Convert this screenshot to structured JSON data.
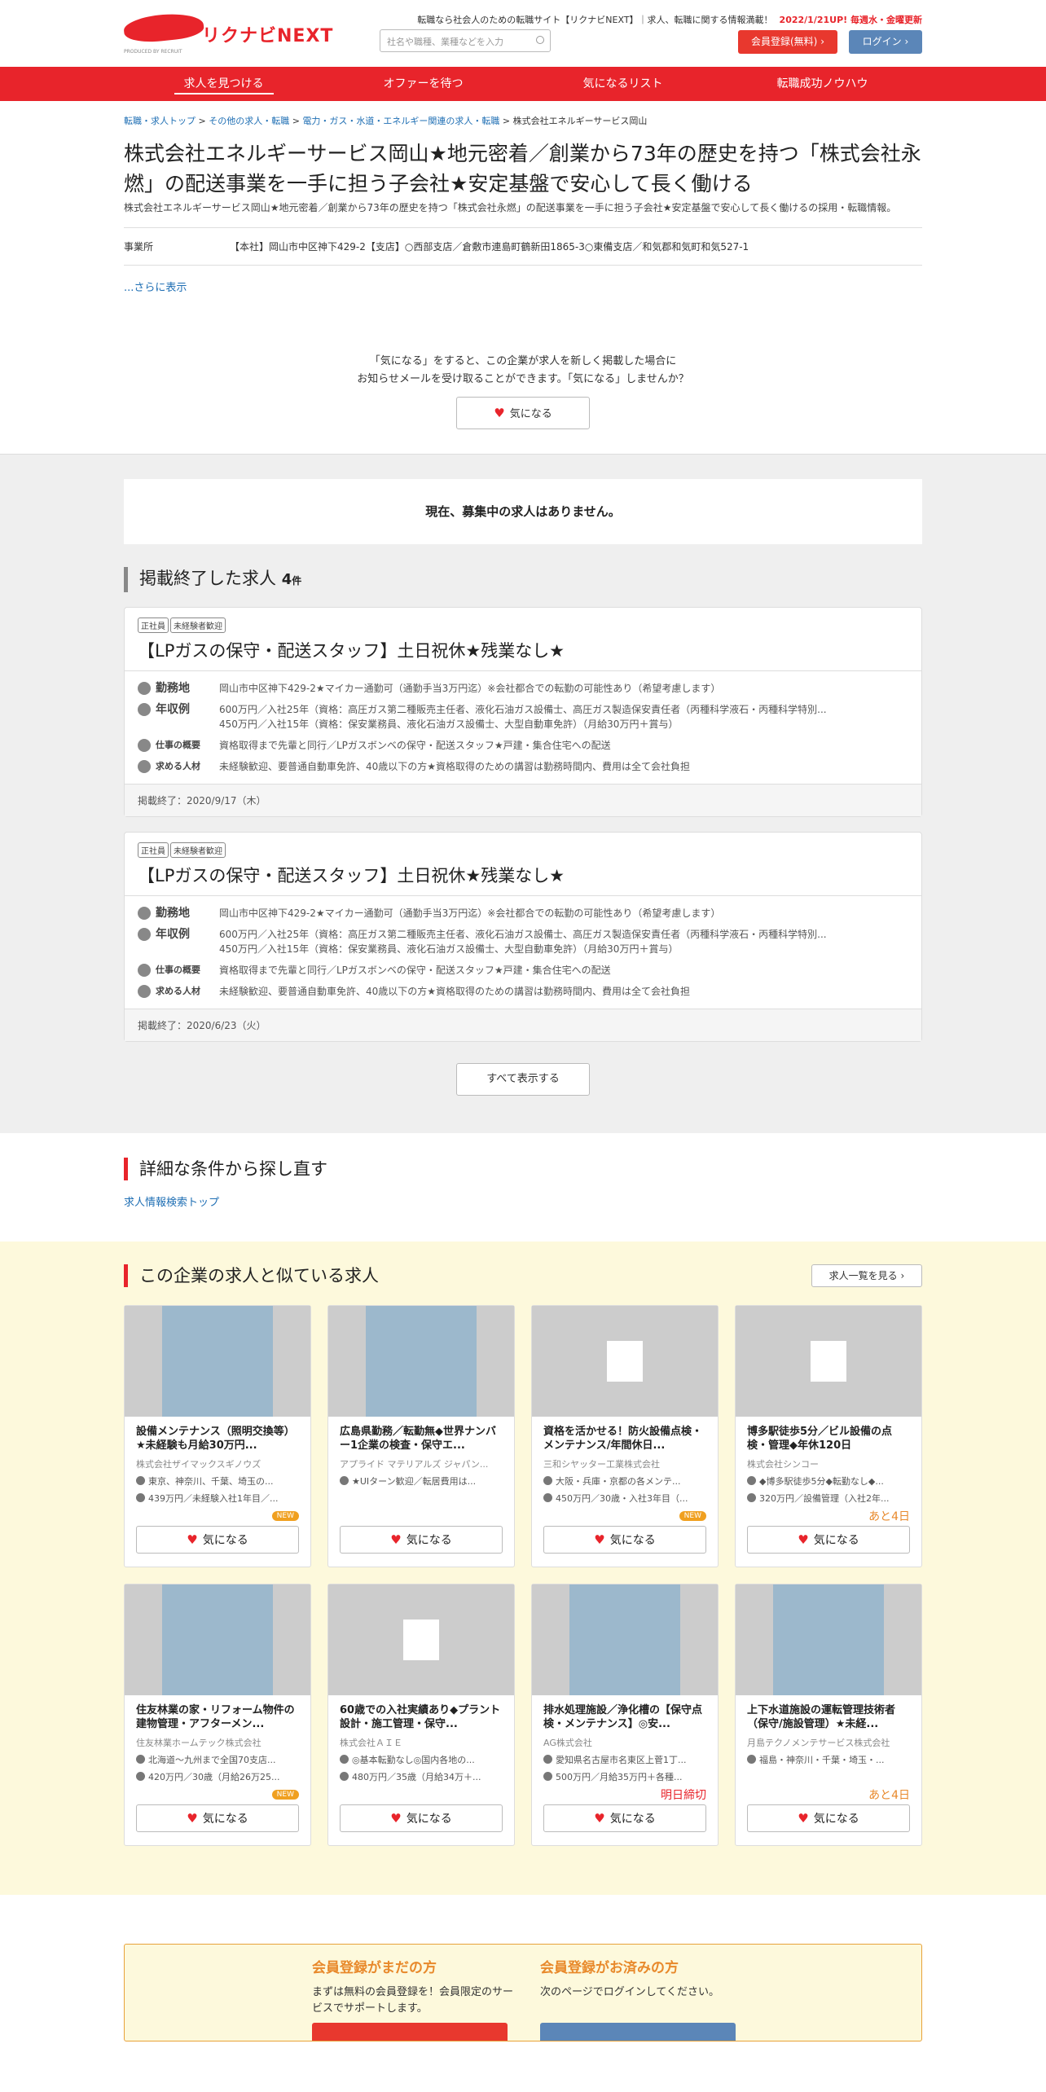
{
  "header": {
    "logo_text": "リクナビNEXT",
    "logo_sub": "PRODUCED BY RECRUIT",
    "tagline": "転職なら社会人のための転職サイト【リクナビNEXT】｜求人、転職に関する情報満載！",
    "update": "2022/1/21UP! 毎週水・金曜更新",
    "search_placeholder": "社名や職種、業種などを入力",
    "register_label": "会員登録(無料)",
    "login_label": "ログイン"
  },
  "nav": [
    "求人を見つける",
    "オファーを待つ",
    "気になるリスト",
    "転職成功ノウハウ"
  ],
  "breadcrumb": [
    "転職・求人トップ",
    "その他の求人・転職",
    "電力・ガス・水道・エネルギー関連の求人・転職",
    "株式会社エネルギーサービス岡山"
  ],
  "company": {
    "title": "株式会社エネルギーサービス岡山★地元密着／創業から73年の歴史を持つ「株式会社永燃」の配送事業を一手に担う子会社★安定基盤で安心して長く働ける",
    "subtitle": "株式会社エネルギーサービス岡山★地元密着／創業から73年の歴史を持つ「株式会社永燃」の配送事業を一手に担う子会社★安定基盤で安心して長く働けるの採用・転職情報。",
    "office_label": "事業所",
    "office_value": "【本社】岡山市中区神下429-2【支店】○西部支店／倉敷市連島町鶴新田1865-3○東備支店／和気郡和気町和気527-1",
    "more": "...さらに表示"
  },
  "favorite": {
    "line1": "「気になる」をすると、この企業が求人を新しく掲載した場合に",
    "line2": "お知らせメールを受け取ることができます。「気になる」しませんか？",
    "button": "気になる"
  },
  "no_jobs": "現在、募集中の求人はありません。",
  "ended": {
    "heading": "掲載終了した求人",
    "count": "4",
    "unit": "件",
    "jobs": [
      {
        "tags": [
          "正社員",
          "未経験者歓迎"
        ],
        "title": "【LPガスの保守・配送スタッフ】土日祝休★残業なし★",
        "loc_label": "勤務地",
        "loc": "岡山市中区神下429-2★マイカー通勤可（通勤手当3万円迄）※会社都合での転勤の可能性あり（希望考慮します）",
        "salary_label": "年収例",
        "salary1": "600万円／入社25年（資格：高圧ガス第二種販売主任者、液化石油ガス設備士、高圧ガス製造保安責任者（丙種科学液石・丙種科学特別...",
        "salary2": "450万円／入社15年（資格：保安業務員、液化石油ガス設備士、大型自動車免許）（月給30万円＋賞与）",
        "work_label": "仕事の概要",
        "work": "資格取得まで先輩と同行／LPガスボンベの保守・配送スタッフ★戸建・集合住宅への配送",
        "req_label": "求める人材",
        "req": "未経験歓迎、要普通自動車免許、40歳以下の方★資格取得のための講習は勤務時間内、費用は全て会社負担",
        "ended": "掲載終了：2020/9/17（木）"
      },
      {
        "tags": [
          "正社員",
          "未経験者歓迎"
        ],
        "title": "【LPガスの保守・配送スタッフ】土日祝休★残業なし★",
        "loc_label": "勤務地",
        "loc": "岡山市中区神下429-2★マイカー通勤可（通勤手当3万円迄）※会社都合での転勤の可能性あり（希望考慮します）",
        "salary_label": "年収例",
        "salary1": "600万円／入社25年（資格：高圧ガス第二種販売主任者、液化石油ガス設備士、高圧ガス製造保安責任者（丙種科学液石・丙種科学特別...",
        "salary2": "450万円／入社15年（資格：保安業務員、液化石油ガス設備士、大型自動車免許）（月給30万円＋賞与）",
        "work_label": "仕事の概要",
        "work": "資格取得まで先輩と同行／LPガスボンベの保守・配送スタッフ★戸建・集合住宅への配送",
        "req_label": "求める人材",
        "req": "未経験歓迎、要普通自動車免許、40歳以下の方★資格取得のための講習は勤務時間内、費用は全て会社負担",
        "ended": "掲載終了：2020/6/23（火）"
      }
    ],
    "show_all": "すべて表示する"
  },
  "redo": {
    "heading": "詳細な条件から探し直す",
    "link": "求人情報検索トップ"
  },
  "similar": {
    "heading": "この企業の求人と似ている求人",
    "list_button": "求人一覧を見る",
    "fav_label": "気になる",
    "cards": [
      {
        "title": "設備メンテナンス（照明交換等）★未経験も月給30万円...",
        "company": "株式会社ザイマックスギノウズ",
        "loc": "東京、神奈川、千葉、埼玉の...",
        "salary": "439万円／未経験入社1年目／...",
        "badge": "NEW",
        "img": "photo"
      },
      {
        "title": "広島県勤務／転勤無◆世界ナンバー1企業の検査・保守エ...",
        "company": "アプライド マテリアルズ ジャパン...",
        "loc": "★UIターン歓迎／転居費用は...",
        "salary": "",
        "badge": "",
        "img": "photo"
      },
      {
        "title": "資格を活かせる！防火設備点検・メンテナンス/年間休日...",
        "company": "三和シヤッター工業株式会社",
        "loc": "大阪・兵庫・京都の各メンテ...",
        "salary": "450万円／30歳・入社3年目（...",
        "badge": "NEW",
        "img": "building"
      },
      {
        "title": "博多駅徒歩5分／ビル設備の点検・管理◆年休120日",
        "company": "株式会社シンコー",
        "loc": "◆博多駅徒歩5分◆転勤なし◆...",
        "salary": "320万円／設備管理（入社2年...",
        "badge": "あと4日",
        "img": "building"
      },
      {
        "title": "住友林業の家・リフォーム物件の建物管理・アフターメン...",
        "company": "住友林業ホームテック株式会社",
        "loc": "北海道～九州まで全国70支店...",
        "salary": "420万円／30歳（月給26万25...",
        "badge": "NEW",
        "img": "photo"
      },
      {
        "title": "60歳での入社実績あり◆プラント設計・施工管理・保守...",
        "company": "株式会社ＡＩＥ",
        "loc": "◎基本転勤なし◎国内各地の...",
        "salary": "480万円／35歳（月給34万＋...",
        "badge": "",
        "img": "building"
      },
      {
        "title": "排水処理施設／浄化槽の【保守点検・メンテナンス】◎安...",
        "company": "AG株式会社",
        "loc": "愛知県名古屋市名東区上菅1丁...",
        "salary": "500万円／月給35万円＋各種...",
        "badge": "明日締切",
        "img": "photo"
      },
      {
        "title": "上下水道施設の運転管理技術者（保守/施設管理）★未経...",
        "company": "月島テクノメンテサービス株式会社",
        "loc": "福島・神奈川・千葉・埼玉・...",
        "salary": "",
        "badge": "あと4日",
        "img": "photo"
      }
    ]
  },
  "member": {
    "new_title": "会員登録がまだの方",
    "new_text": "まずは無料の会員登録を！会員限定のサービスでサポートします。",
    "exist_title": "会員登録がお済みの方",
    "exist_text": "次のページでログインしてください。"
  }
}
